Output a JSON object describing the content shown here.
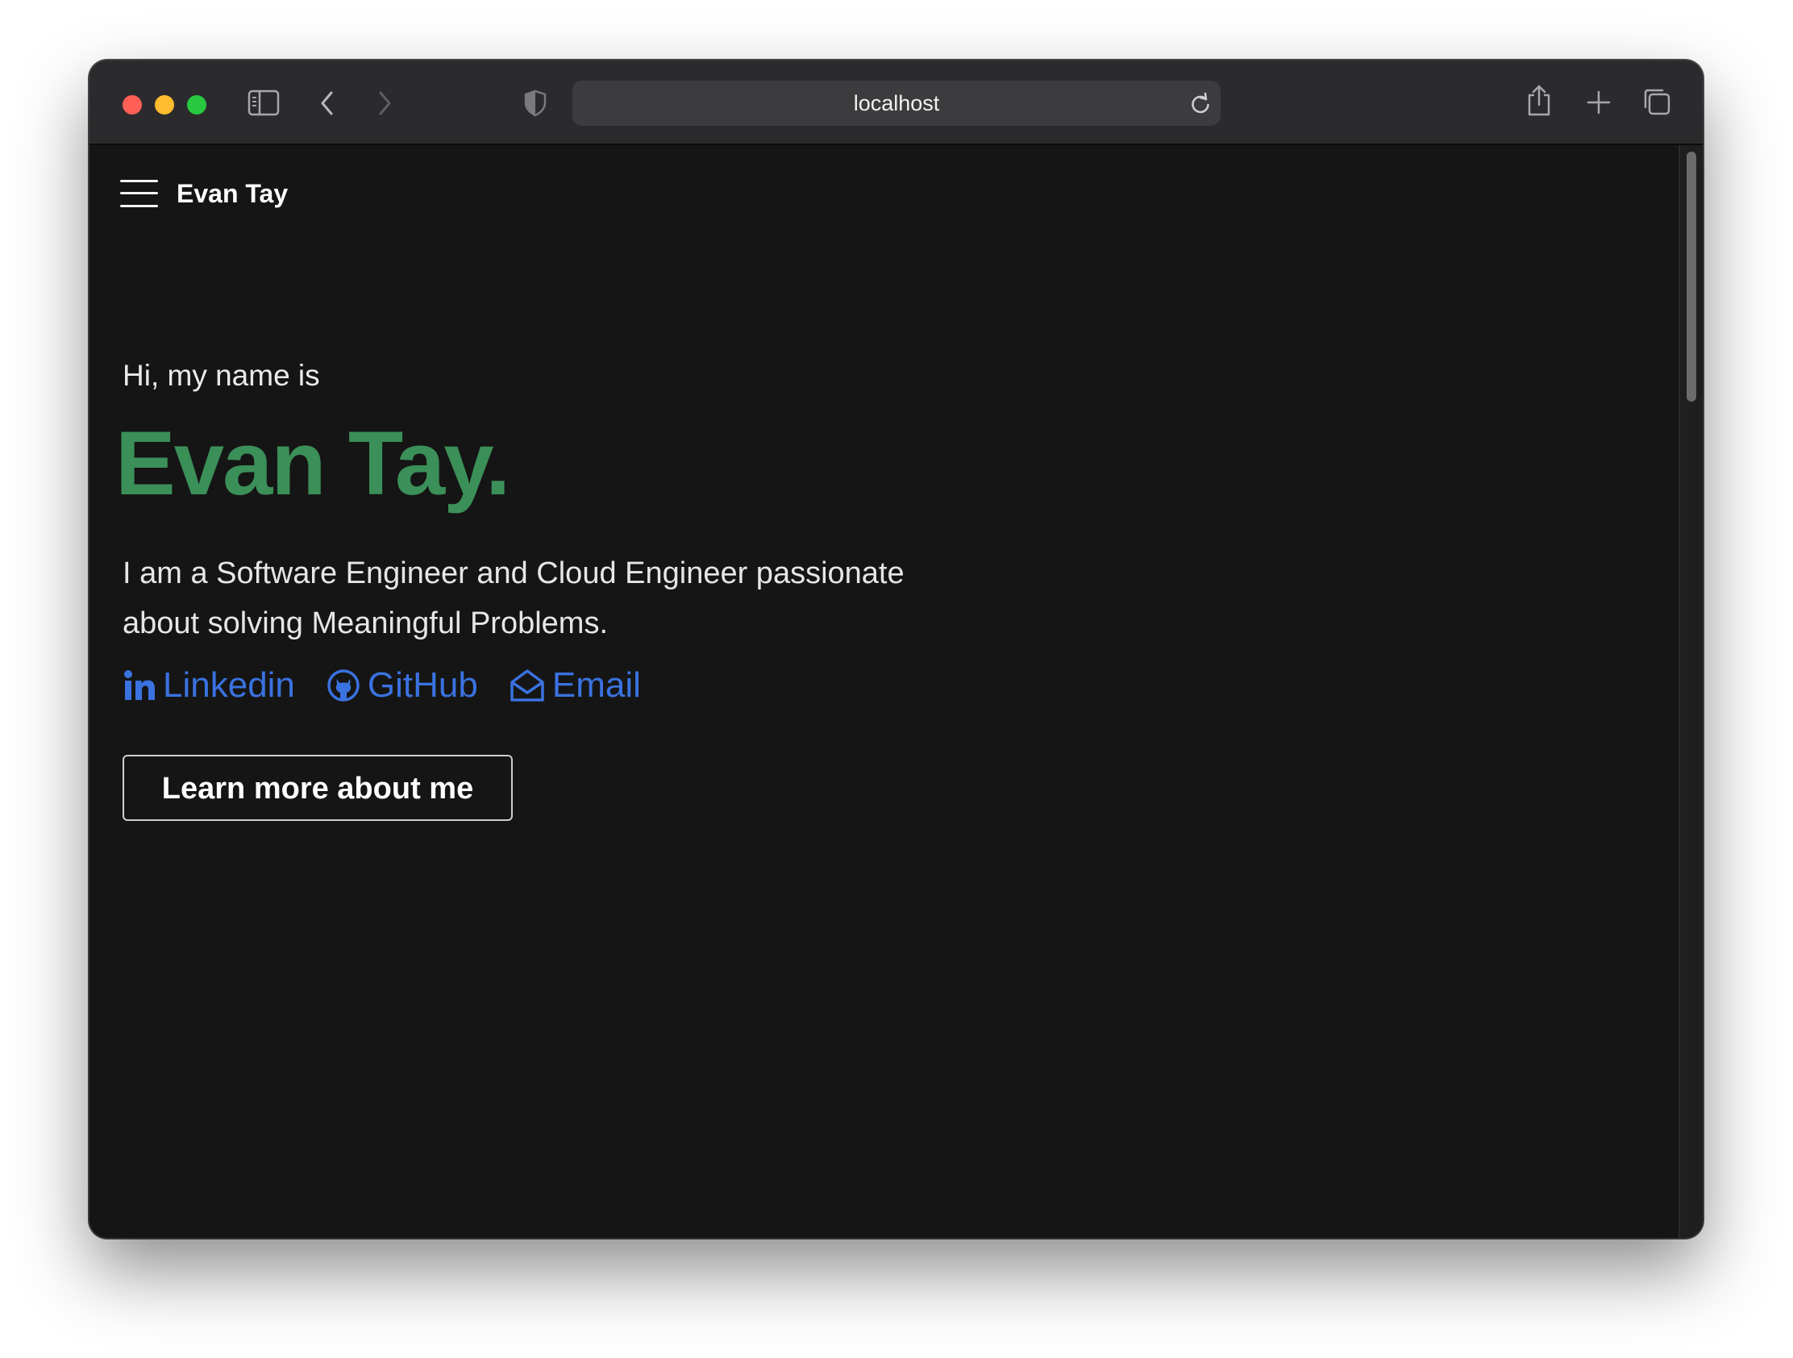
{
  "browser": {
    "address": "localhost",
    "icons": {
      "sidebar": "sidebar-icon",
      "back": "chevron-left-icon",
      "forward": "chevron-right-icon",
      "privacy": "shield-icon",
      "reload": "reload-icon",
      "share": "share-icon",
      "new_tab": "plus-icon",
      "tabs": "tab-overview-icon"
    },
    "traffic_lights": {
      "close": "#fe5f57",
      "minimize": "#febc2e",
      "zoom": "#28c840"
    }
  },
  "nav": {
    "brand": "Evan Tay"
  },
  "hero": {
    "greeting": "Hi, my name is",
    "name": "Evan Tay.",
    "tagline": "I am a Software Engineer and Cloud Engineer passionate about solving Meaningful Problems.",
    "links": [
      {
        "label": "Linkedin",
        "icon": "linkedin-icon"
      },
      {
        "label": "GitHub",
        "icon": "github-icon"
      },
      {
        "label": "Email",
        "icon": "envelope-open-icon"
      }
    ],
    "cta_label": "Learn more about me"
  },
  "colors": {
    "page_background": "#151515",
    "accent_green": "#3b8f58",
    "link_blue": "#3a72e0",
    "toolbar": "#2b2b2d"
  }
}
